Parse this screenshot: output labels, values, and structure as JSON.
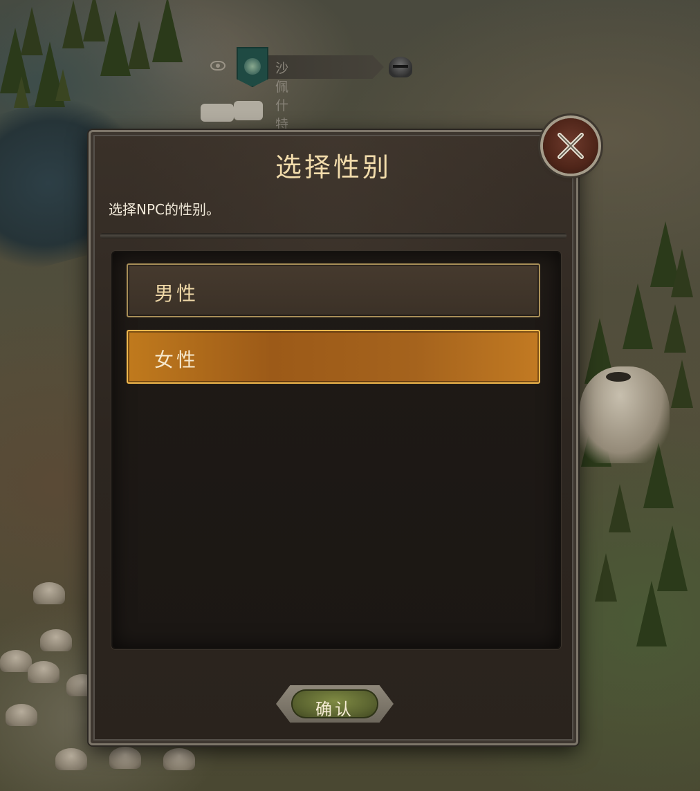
{
  "map": {
    "settlement_name": "沙佩什特"
  },
  "dialog": {
    "title": "选择性别",
    "description": "选择NPC的性别。",
    "options": [
      {
        "label": "男性",
        "selected": false
      },
      {
        "label": "女性",
        "selected": true
      }
    ],
    "confirm_label": "确认"
  },
  "icons": {
    "visibility": "eye-icon",
    "faction": "shield-emblem-icon",
    "army": "helmet-icon",
    "close": "close-icon"
  },
  "colors": {
    "title_gold": "#f2dcab",
    "selected_option": "#b06b1c",
    "option_border": "#a98f58",
    "confirm_green": "#6b7538",
    "close_red": "#5a2a1d"
  }
}
